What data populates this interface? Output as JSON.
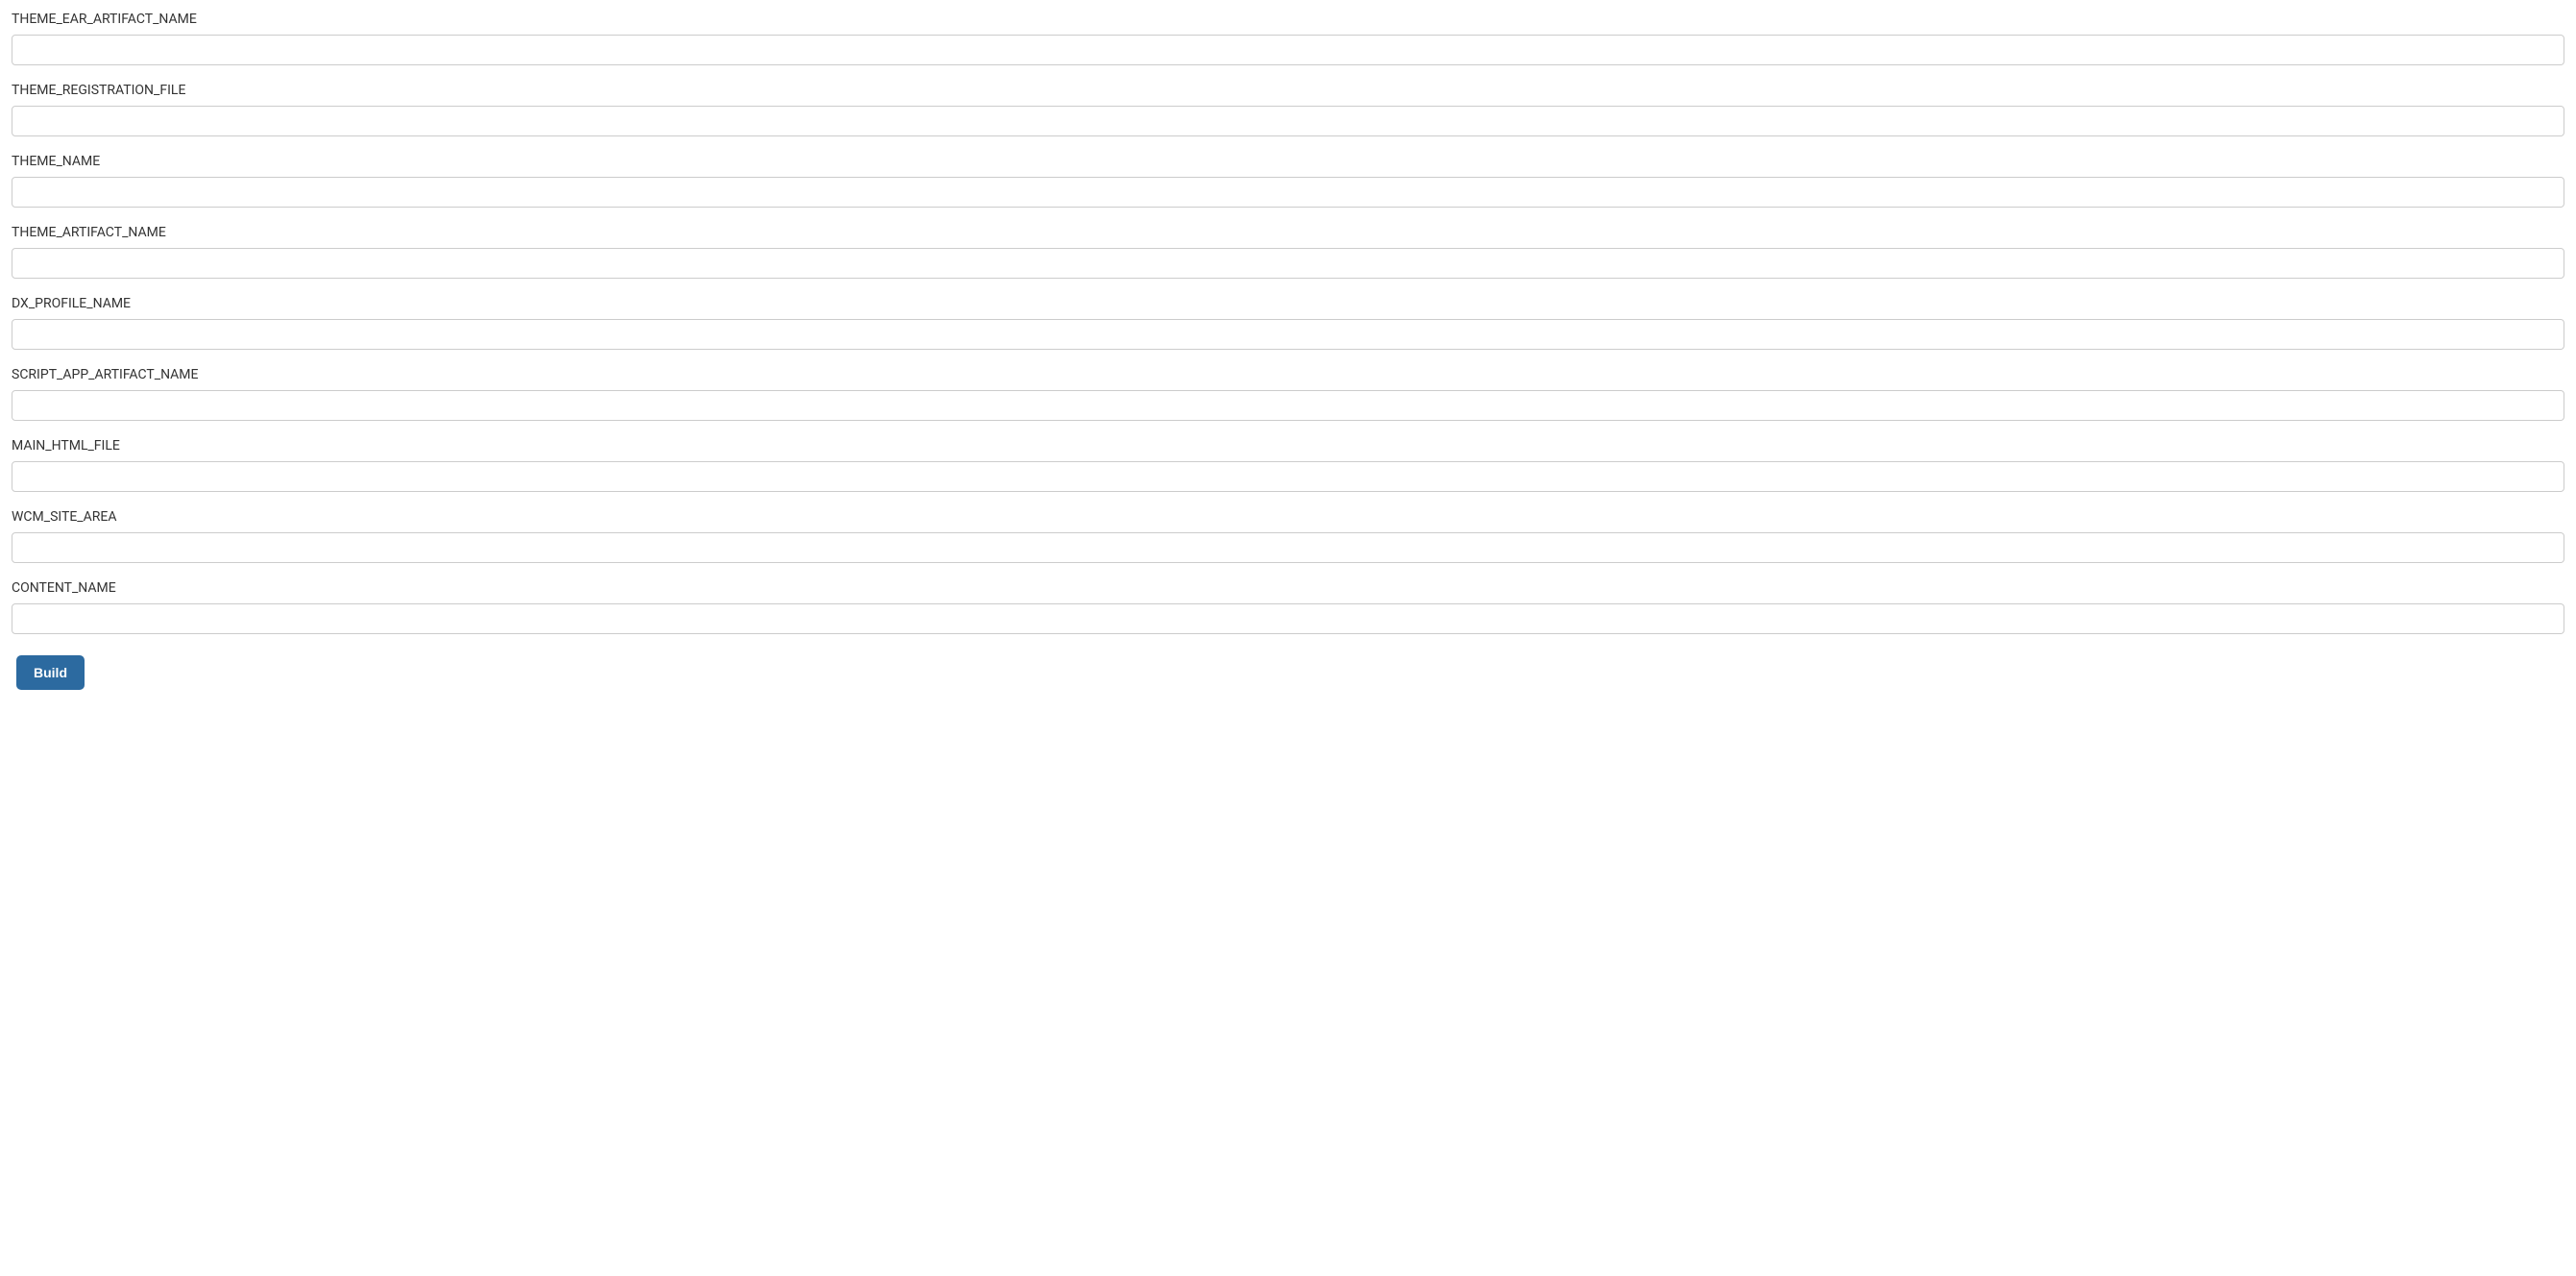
{
  "form": {
    "fields": [
      {
        "key": "theme-ear-artifact-name",
        "label": "THEME_EAR_ARTIFACT_NAME",
        "value": ""
      },
      {
        "key": "theme-registration-file",
        "label": "THEME_REGISTRATION_FILE",
        "value": ""
      },
      {
        "key": "theme-name",
        "label": "THEME_NAME",
        "value": ""
      },
      {
        "key": "theme-artifact-name",
        "label": "THEME_ARTIFACT_NAME",
        "value": ""
      },
      {
        "key": "dx-profile-name",
        "label": "DX_PROFILE_NAME",
        "value": ""
      },
      {
        "key": "script-app-artifact-name",
        "label": "SCRIPT_APP_ARTIFACT_NAME",
        "value": ""
      },
      {
        "key": "main-html-file",
        "label": "MAIN_HTML_FILE",
        "value": ""
      },
      {
        "key": "wcm-site-area",
        "label": "WCM_SITE_AREA",
        "value": ""
      },
      {
        "key": "content-name",
        "label": "CONTENT_NAME",
        "value": ""
      }
    ],
    "build_label": "Build"
  }
}
